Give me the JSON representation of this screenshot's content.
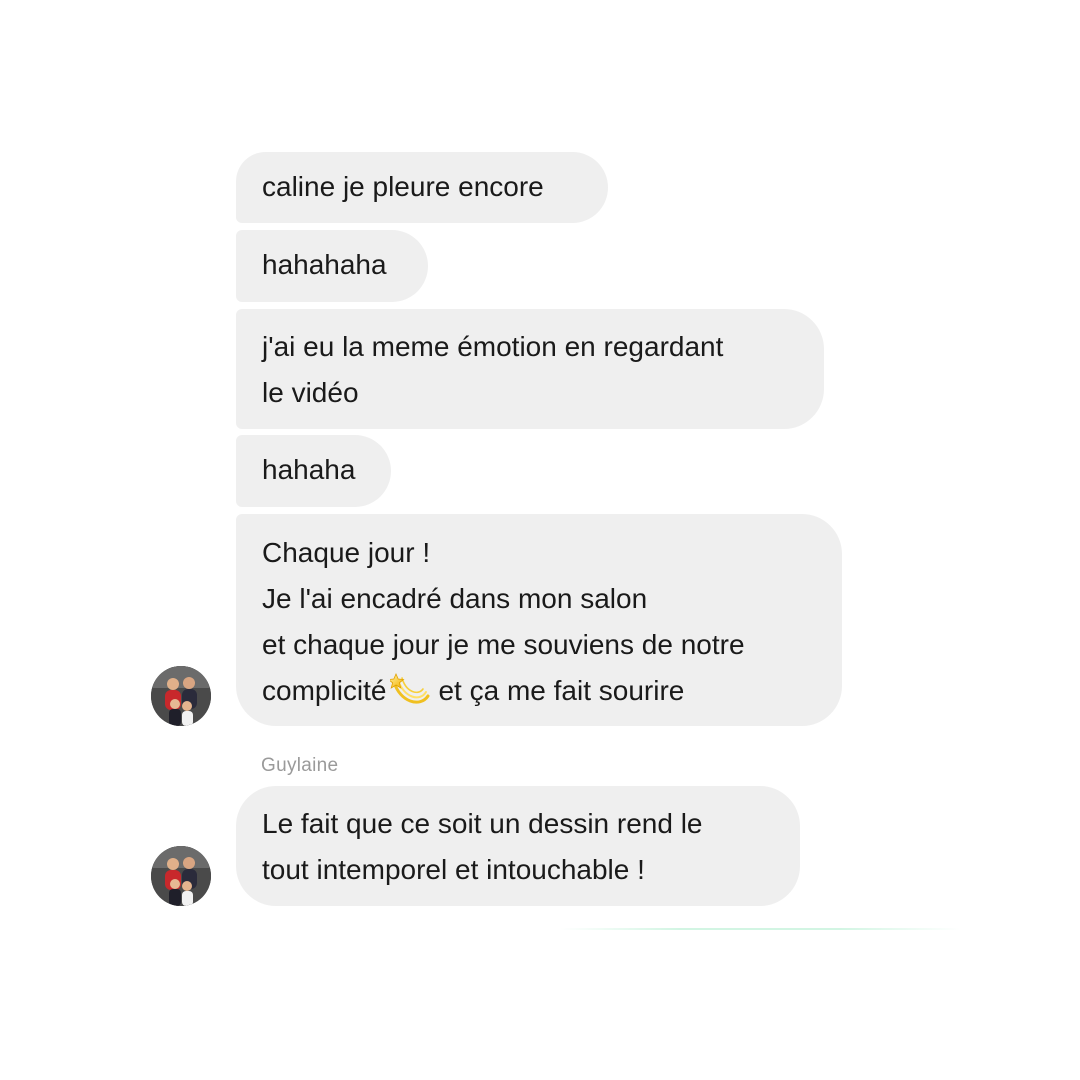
{
  "conversation": {
    "messages": [
      {
        "lines": [
          "caline je pleure encore"
        ]
      },
      {
        "lines": [
          "hahahaha"
        ]
      },
      {
        "lines": [
          "j'ai eu la meme émotion en regardant",
          "le vidéo"
        ]
      },
      {
        "lines": [
          "hahaha"
        ]
      },
      {
        "lines": [
          "Chaque jour !",
          "Je l'ai encadré dans mon salon",
          "et chaque jour je me souviens de notre",
          "complicité",
          "et ça me fait sourire"
        ]
      }
    ],
    "second_group": {
      "sender_name": "Guylaine",
      "messages": [
        {
          "lines": [
            "Le fait que ce soit un dessin rend le",
            "tout intemporel et intouchable !"
          ]
        }
      ]
    },
    "icons": {
      "inline_emoji": "dizzy-emoji",
      "avatar": "group-photo-avatar"
    },
    "colors": {
      "bubble_bg": "#efefef",
      "text": "#1a1a1a",
      "sender_name": "#9a9a9a",
      "background": "#ffffff"
    }
  }
}
